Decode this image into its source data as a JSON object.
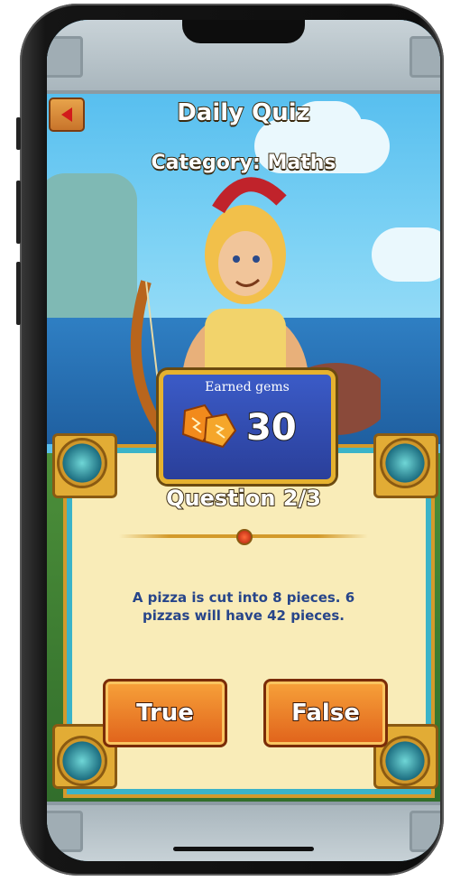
{
  "header": {
    "title": "Daily Quiz",
    "category": "Category: Maths"
  },
  "gems": {
    "label": "Earned gems",
    "value": "30"
  },
  "quiz": {
    "question_label": "Question 2/3",
    "question_text": "A pizza is cut into 8 pieces. 6 pizzas will have 42 pieces.",
    "answers": {
      "true_label": "True",
      "false_label": "False"
    }
  },
  "icons": {
    "back": "back-arrow-icon",
    "gem": "gem-icon"
  },
  "colors": {
    "sky": "#45b5ec",
    "card_bg": "#f9ecb8",
    "button_orange": "#e0621b",
    "question_text": "#27458a",
    "gems_panel": "#2a3f9a"
  }
}
